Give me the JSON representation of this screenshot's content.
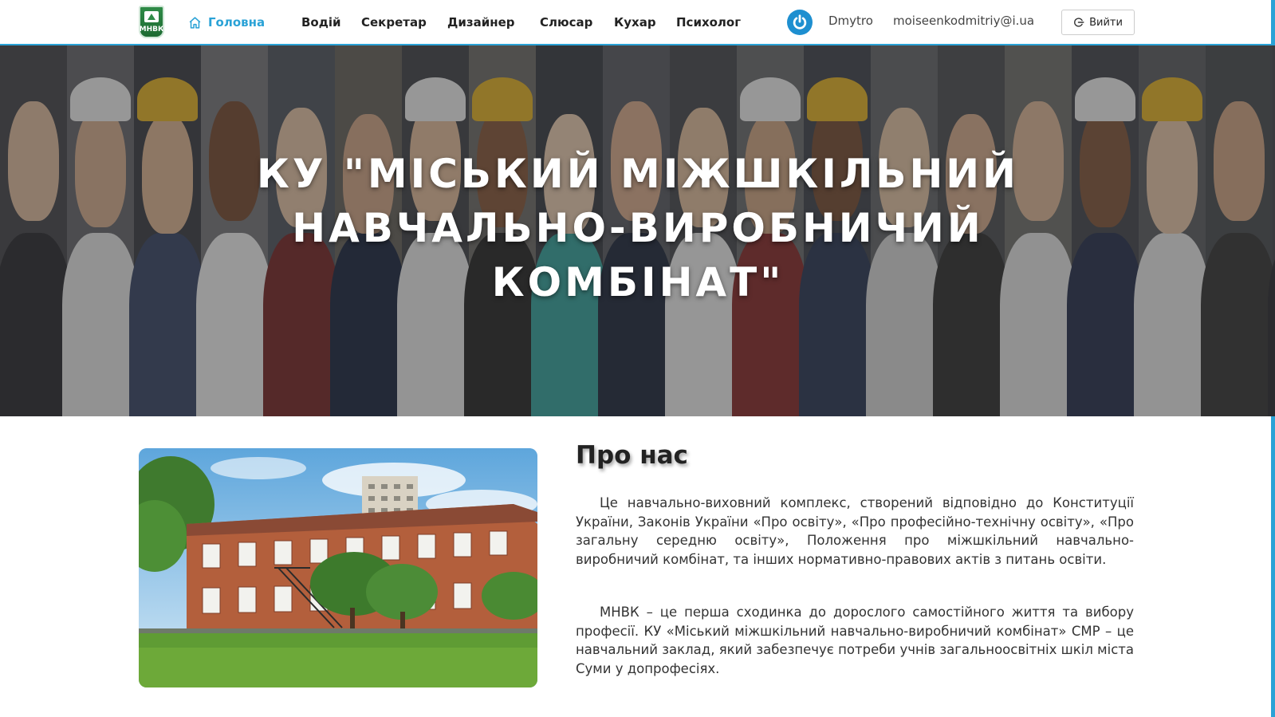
{
  "navbar": {
    "logo_text": "МНВК",
    "home_label": "Головна",
    "items": [
      {
        "label": "Водій"
      },
      {
        "label": "Секретар"
      },
      {
        "label": "Дизайнер"
      },
      {
        "label": "Слюсар"
      },
      {
        "label": "Кухар"
      },
      {
        "label": "Психолог"
      }
    ],
    "user_name": "Dmytro",
    "user_email": "moiseenkodmitriy@i.ua",
    "logout_label": "Вийти",
    "icons": {
      "home": "home-icon",
      "power": "power-icon",
      "logout": "logout-icon"
    }
  },
  "hero": {
    "title_line1": "КУ \"МІСЬКИЙ МІЖШКІЛЬНИЙ",
    "title_line2": "НАВЧАЛЬНО-ВИРОБНИЧИЙ",
    "title_line3": "КОМБІНАТ\""
  },
  "about": {
    "title": "Про нас",
    "paragraph1": "Це навчально-виховний комплекс, створений відповідно до Конституції України, Законів України «Про освіту», «Про професійно-технічну освіту», «Про загальну середню освіту», Положення про міжшкільний навчально-виробничий комбінат, та інших нормативно-правових актів з питань освіти.",
    "paragraph2": "МНВК – це перша сходинка до дорослого самостійного життя та вибору професії. КУ «Міський міжшкільний навчально-виробничий комбінат» СМР – це навчальний заклад, який забезпечує потреби учнів загальноосвітніх шкіл міста Суми у допрофесіях."
  },
  "colors": {
    "accent": "#2aa2d6",
    "power_icon": "#1e8fd0",
    "logo_green": "#2f8b47"
  }
}
